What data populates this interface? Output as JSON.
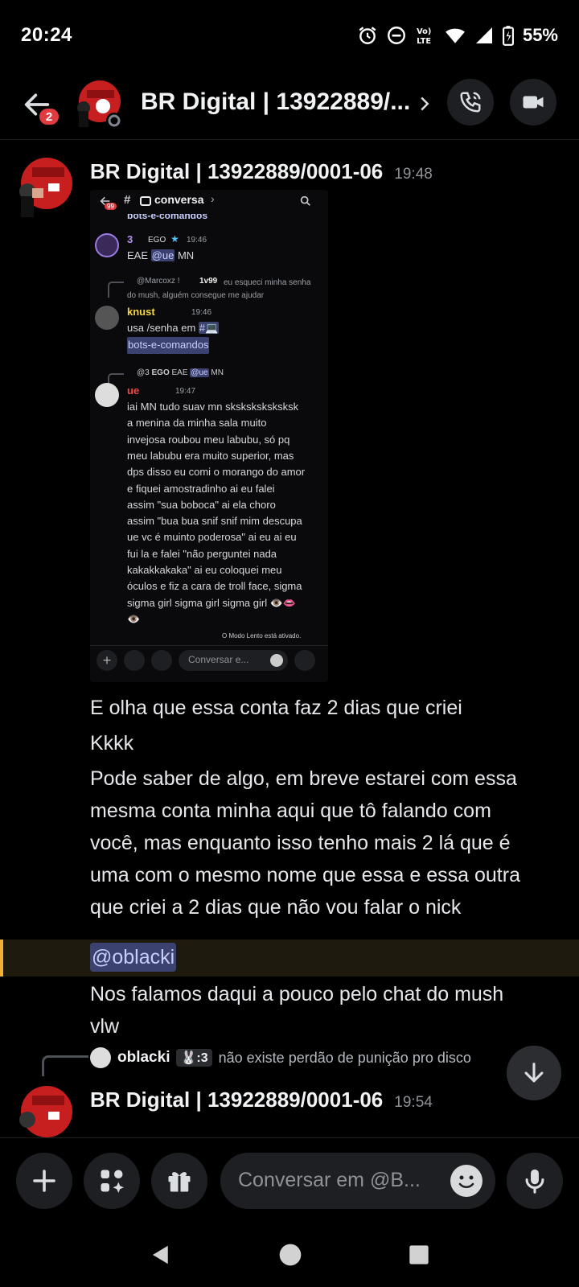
{
  "status_bar": {
    "time": "20:24",
    "battery": "55%",
    "icons": [
      "alarm-icon",
      "dnd-icon",
      "volte-icon",
      "wifi-icon",
      "signal-icon",
      "battery-icon"
    ]
  },
  "header": {
    "title": "BR Digital | 13922889/...",
    "badge_count": "2",
    "icons": [
      "back-arrow-icon",
      "chevron-right-icon",
      "phone-icon",
      "video-icon"
    ]
  },
  "messages": [
    {
      "author": "BR Digital | 13922889/0001-06",
      "timestamp": "19:48",
      "embedded_screenshot": {
        "channel": "conversa",
        "channel_above": "bots-e-comandos",
        "badge": "99",
        "msg1": {
          "author": "3",
          "tag": "EGO",
          "time": "19:46",
          "text_before": "EAE",
          "mention": "@ue",
          "text_after": "MN"
        },
        "reply1": {
          "name": "@Marcoxz !",
          "tag": "1v99",
          "text": "eu esqueci minha senha do mush, alguém consegue me ajudar"
        },
        "msg2": {
          "author": "knust",
          "time": "19:46",
          "line1": "usa /senha em",
          "channel": "bots-e-comandos"
        },
        "reply2": {
          "name": "@3",
          "tag": "EGO",
          "text_before": "EAE",
          "mention": "@ue",
          "text_after": "MN"
        },
        "msg3": {
          "author": "ue",
          "time": "19:47",
          "lines": [
            "iai MN tudo suav mn sksksksksksksk",
            "a menina da minha sala muito",
            "invejosa roubou meu labubu, só pq",
            "meu labubu era muito superior, mas",
            "dps disso eu comi o morango do amor",
            "e fiquei amostradinho ai eu falei",
            "assim \"sua boboca\" ai ela choro",
            "assim \"bua bua snif snif mim descupa",
            "ue vc é muinto poderosa\" ai eu ai eu",
            "fui la e falei \"não perguntei nada",
            "kakakkakaka\" ai eu coloquei meu",
            "óculos e fiz a cara de troll face, sigma",
            "sigma girl sigma girl sigma girl 👁️👄",
            "👁️"
          ]
        },
        "slow_mode": "O Modo Lento está ativado.",
        "composer_placeholder": "Conversar e..."
      },
      "lines": [
        "E olha que essa conta faz 2 dias que criei",
        "Kkkk"
      ],
      "paragraph": [
        "Pode saber de algo, em breve estarei com essa",
        "mesma conta minha aqui que tô falando com",
        "você, mas enquanto isso tenho mais 2 lá que é",
        "uma com o mesmo nome que essa e essa outra",
        "que criei a 2 dias que não vou falar o nick"
      ],
      "mention": "@oblacki",
      "closing": [
        "Nos falamos daqui a pouco pelo chat do mush",
        "vlw"
      ]
    },
    {
      "reply_to": {
        "name": "oblacki",
        "tag": "🐰:3",
        "text": "não existe perdão de punição pro disco"
      },
      "author": "BR Digital | 13922889/0001-06",
      "timestamp": "19:54"
    }
  ],
  "composer": {
    "placeholder": "Conversar em @B...",
    "icons": [
      "plus-icon",
      "apps-icon",
      "gift-icon",
      "emoji-icon",
      "mic-icon"
    ]
  },
  "navbar": {
    "icons": [
      "back-triangle-icon",
      "home-circle-icon",
      "recents-square-icon"
    ]
  },
  "colors": {
    "mention_bar": "#f0b232",
    "mention_bg": "#3c4270",
    "badge": "#e03b3f"
  }
}
